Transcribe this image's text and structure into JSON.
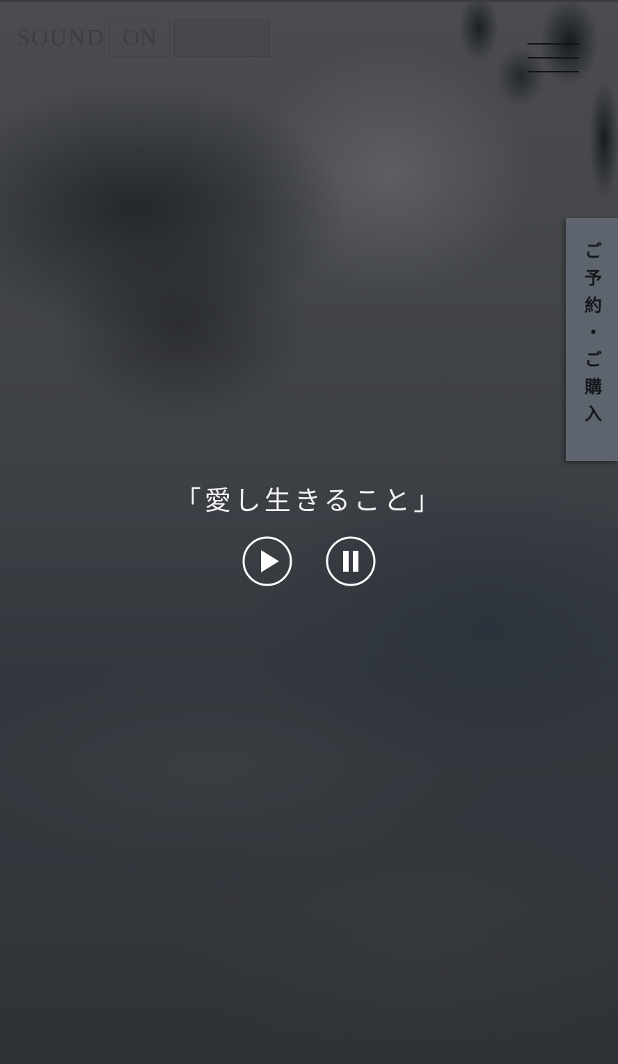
{
  "header": {
    "logo_text": "SOUND",
    "logo_box_text": "ON",
    "menu_icon": "hamburger-menu-icon"
  },
  "side_tab": {
    "label": "ご予約・ご購入"
  },
  "main": {
    "title": "「愛し生きること」"
  },
  "player": {
    "play_icon": "play-icon",
    "pause_icon": "pause-icon"
  },
  "colors": {
    "side_tab_bg": "#5d646d",
    "title_text": "#f2f2f2",
    "control_stroke": "#ffffff"
  }
}
